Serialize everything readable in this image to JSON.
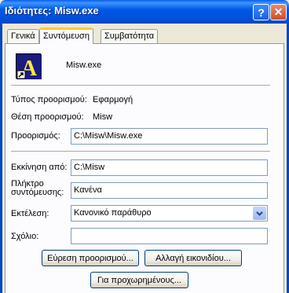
{
  "window": {
    "title": "Ιδιότητες: Misw.exe"
  },
  "titlebar": {
    "help_glyph": "?",
    "close_glyph": "✕"
  },
  "tabs": [
    {
      "label": "Γενικά",
      "active": false
    },
    {
      "label": "Συντόμευση",
      "active": true
    },
    {
      "label": "Συμβατότητα",
      "active": false
    }
  ],
  "header": {
    "icon_letter": "A",
    "name": "Misw.exe"
  },
  "info": {
    "target_type_label": "Τύπος προορισμού:",
    "target_type_value": "Εφαρμογή",
    "target_location_label": "Θέση προορισμού:",
    "target_location_value": "Misw"
  },
  "form": {
    "target_label": "Προορισμός:",
    "target_value": "C:\\Misw\\Misw.exe",
    "start_in_label": "Εκκίνηση από:",
    "start_in_value": "C:\\Misw",
    "shortcut_key_label_line1": "Πλήκτρο",
    "shortcut_key_label_line2": "συντόμευσης:",
    "shortcut_key_value": "Κανένα",
    "run_label": "Εκτέλεση:",
    "run_value": "Κανονικό παράθυρο",
    "comment_label": "Σχόλιο:",
    "comment_value": ""
  },
  "buttons": {
    "find_target": "Εύρεση προορισμού...",
    "change_icon": "Αλλαγή εικονιδίου...",
    "advanced": "Για προχωρημένους..."
  },
  "colors": {
    "titlebar": "#0058E6",
    "dialog_bg": "#ECE9D8",
    "tab_highlight": "#FFC83C"
  }
}
